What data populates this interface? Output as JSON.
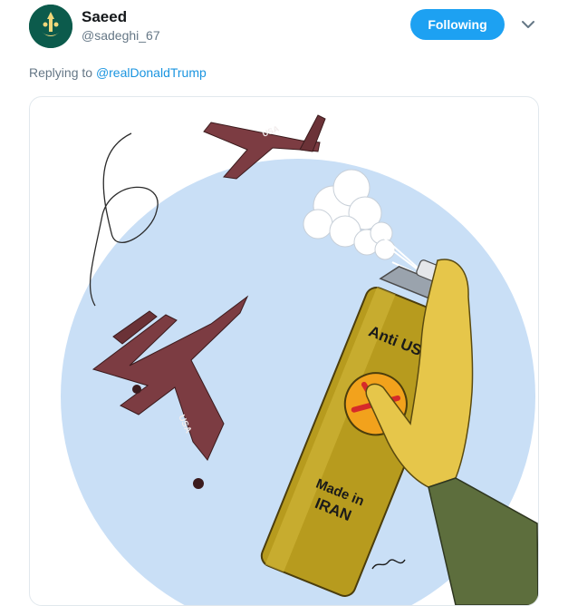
{
  "tweet": {
    "author": {
      "name": "Saeed",
      "handle": "@sadeghi_67"
    },
    "follow_label": "Following",
    "replying_prefix": "Replying to",
    "replying_to": "@realDonaldTrump"
  },
  "media": {
    "drone_top_text": "USA",
    "drone_falling_text": "USA",
    "can_top_text": "Anti USA",
    "can_bottom_text_1": "Made in",
    "can_bottom_text_2": "IRAN"
  },
  "colors": {
    "accent": "#1da1f2",
    "link": "#1b95e0",
    "secondary_text": "#657786",
    "sky": "#c9dff6"
  }
}
